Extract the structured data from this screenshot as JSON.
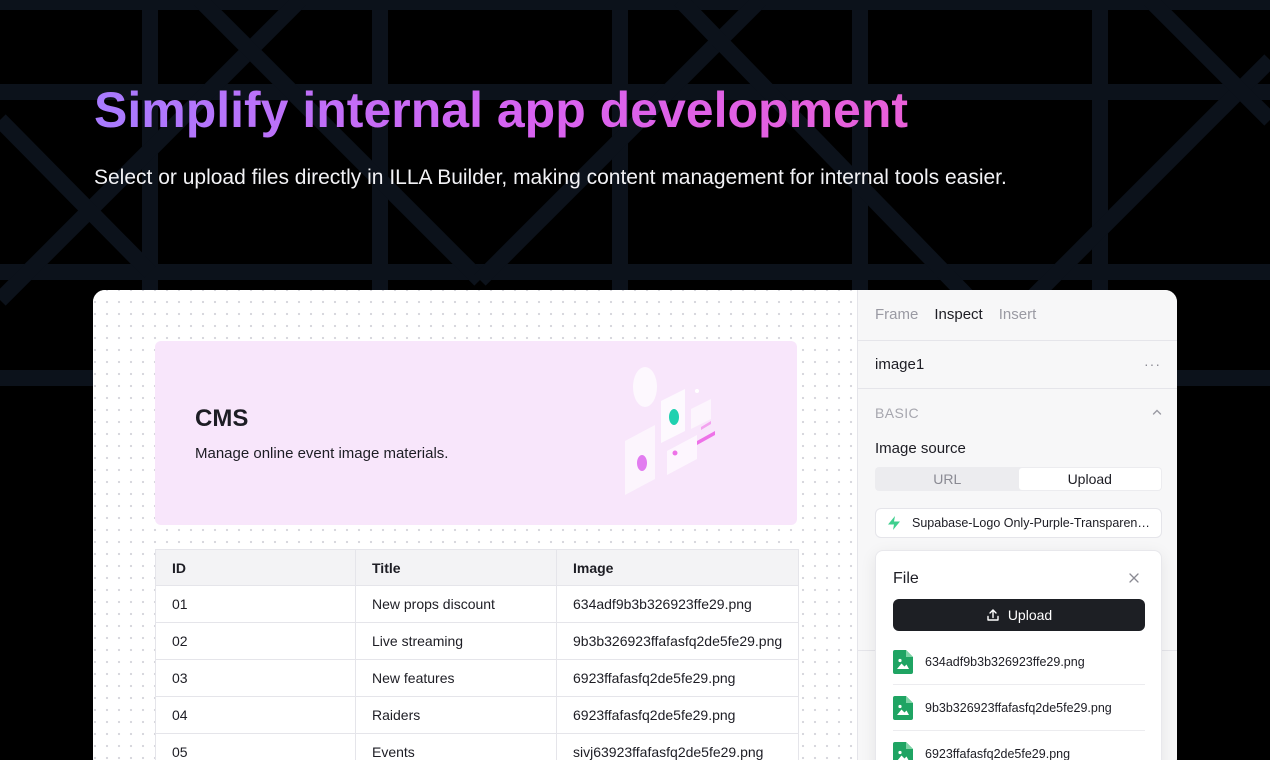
{
  "hero": {
    "title": "Simplify internal app development",
    "subtitle": "Select or upload files directly in ILLA Builder, making content management for internal tools easier."
  },
  "banner": {
    "title": "CMS",
    "description": "Manage online event image materials."
  },
  "table": {
    "columns": [
      "ID",
      "Title",
      "Image"
    ],
    "rows": [
      [
        "01",
        "New props discount",
        "634adf9b3b326923ffe29.png"
      ],
      [
        "02",
        "Live streaming",
        "9b3b326923ffafasfq2de5fe29.png"
      ],
      [
        "03",
        "New features",
        "6923ffafasfq2de5fe29.png"
      ],
      [
        "04",
        "Raiders",
        "6923ffafasfq2de5fe29.png"
      ],
      [
        "05",
        "Events",
        "sivj63923ffafasfq2de5fe29.png"
      ]
    ]
  },
  "inspector": {
    "tabs": [
      {
        "label": "Frame",
        "active": false
      },
      {
        "label": "Inspect",
        "active": true
      },
      {
        "label": "Insert",
        "active": false
      }
    ],
    "component_name": "image1",
    "more_label": "···",
    "section_label": "BASIC",
    "field_label": "Image source",
    "segments": [
      {
        "label": "URL",
        "active": false
      },
      {
        "label": "Upload",
        "active": true
      }
    ],
    "selected_file": "Supabase-Logo Only-Purple-Transparent.png",
    "popover": {
      "title": "File",
      "upload_label": "Upload",
      "files": [
        "634adf9b3b326923ffe29.png",
        "9b3b326923ffafasfq2de5fe29.png",
        "6923ffafasfq2de5fe29.png"
      ]
    }
  },
  "colors": {
    "accent_gradient_start": "#a87bff",
    "accent_gradient_end": "#e95fd8",
    "banner_bg": "#f8e6fb",
    "supabase_green": "#3ecf8e",
    "file_icon_green": "#1fa463",
    "button_dark": "#1d1f24"
  },
  "icons": {
    "file_select": "supabase-bolt-icon",
    "upload": "upload-icon",
    "file_item": "image-file-icon",
    "close": "close-icon",
    "collapse": "chevron-up-icon"
  }
}
